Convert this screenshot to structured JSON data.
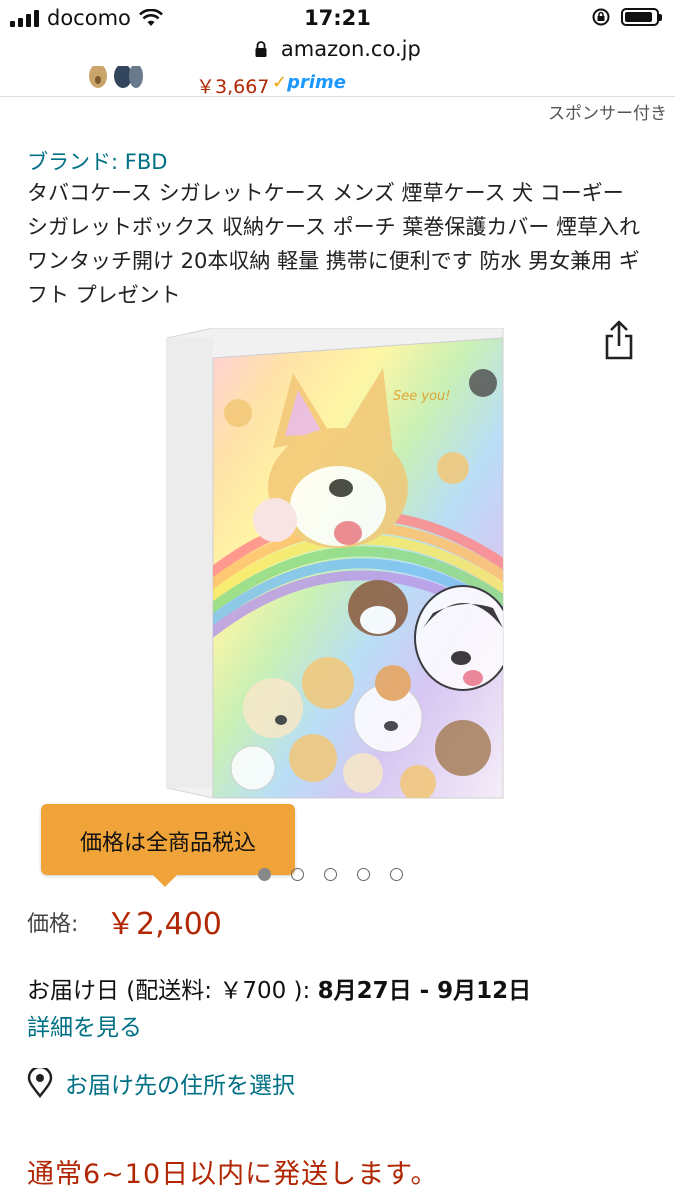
{
  "status_bar": {
    "carrier": "docomo",
    "time": "17:21",
    "battery_level": 0.9
  },
  "url_bar": {
    "domain": "amazon.co.jp",
    "lock_icon": "lock-icon"
  },
  "top_strip": {
    "price": "￥3,667",
    "prime_label": "prime"
  },
  "sponsor_label": "スポンサー付き",
  "brand_link": "ブランド: FBD",
  "product_title": "タバコケース シガレットケース メンズ 煙草ケース 犬 コーギー シガレットボックス 収納ケース ポーチ 葉巻保護カバー 煙草入れ ワンタッチ開け 20本収納 軽量 携帯に便利です 防水 男女兼用 ギフト プレゼント",
  "image_text": "See you!",
  "share_icon": "share-icon",
  "tooltip": {
    "text": "価格は全商品税込"
  },
  "carousel": {
    "count": 5,
    "active_index": 0
  },
  "price": {
    "label": "価格:",
    "value": "￥2,400"
  },
  "delivery": {
    "prefix": "お届け日 (配送料: ￥700 ):",
    "dates": "8月27日 - 9月12日"
  },
  "details_link": "詳細を見る",
  "address_link": "お届け先の住所を選択",
  "shipping_note": "通常6~10日以内に発送します。",
  "colors": {
    "price_red": "#b12704",
    "link_teal": "#007185",
    "tooltip_orange": "#f0a338",
    "prime_blue": "#1a98ff"
  }
}
